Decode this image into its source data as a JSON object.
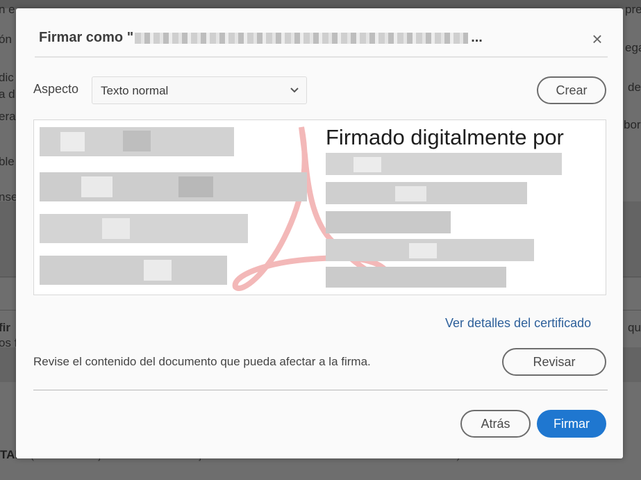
{
  "background": {
    "fragments": [
      "n e",
      "ón",
      "dic",
      "a d",
      "era",
      "ble",
      "nse",
      "fir",
      "os f",
      "pre",
      "ega",
      "de",
      "bor",
      "qu"
    ],
    "footer_bold": "TAN:",
    "footer_text": "(A efectos de justificación debe adjuntarse a esta solicitud la documentación necesaria)"
  },
  "dialog": {
    "title_prefix": "Firmar como \"",
    "title_suffix": "...",
    "close_glyph": "×",
    "aspect_label": "Aspecto",
    "aspect_value": "Texto normal",
    "create_button": "Crear",
    "signature_heading": "Firmado digitalmente por",
    "certificate_link": "Ver detalles del certificado",
    "review_text": "Revise el contenido del documento que pueda afectar a la firma.",
    "review_button": "Revisar",
    "back_button": "Atrás",
    "sign_button": "Firmar"
  },
  "colors": {
    "primary": "#1f77d0",
    "link": "#2c5f9a",
    "dialog_bg": "#fafafa",
    "overlay": "#6e6e6e"
  }
}
